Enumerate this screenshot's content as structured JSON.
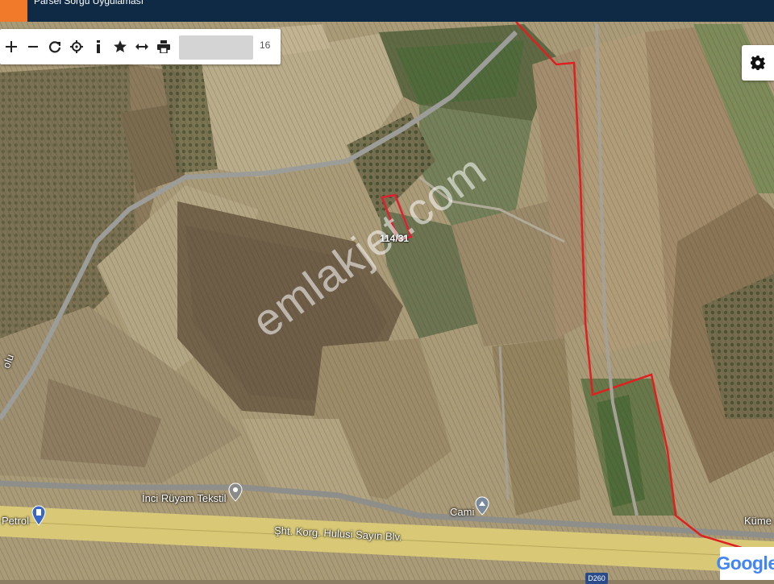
{
  "header": {
    "app_title": "Parsel Sorgu Uygulaması"
  },
  "toolbar": {
    "tools": [
      {
        "name": "zoom-in",
        "glyph": "+"
      },
      {
        "name": "zoom-out",
        "glyph": "−"
      },
      {
        "name": "refresh",
        "glyph": "↻"
      },
      {
        "name": "locate",
        "glyph": "⌖"
      },
      {
        "name": "info",
        "glyph": "i"
      },
      {
        "name": "favorite",
        "glyph": "★"
      },
      {
        "name": "measure",
        "glyph": "↔"
      },
      {
        "name": "print",
        "glyph": "🖶"
      }
    ],
    "search_value": "",
    "zoom_level": "16"
  },
  "map": {
    "parcel_label": "114/31",
    "labels": {
      "inci_ruyam": "İnci Rüyam Tekstil",
      "cami": "Cami",
      "petrol": "Petrol",
      "boulevard": "Şht. Korg. Hulusi Sayın Blv.",
      "kume": "Küme E",
      "yolu": "olu"
    },
    "road_shield": "D260",
    "watermark": "emlakjet.com",
    "attribution": "Google"
  },
  "colors": {
    "header_bg": "#0f2a45",
    "accent": "#f07a2a",
    "boundary": "#e02020",
    "highway": "#d9c977"
  }
}
